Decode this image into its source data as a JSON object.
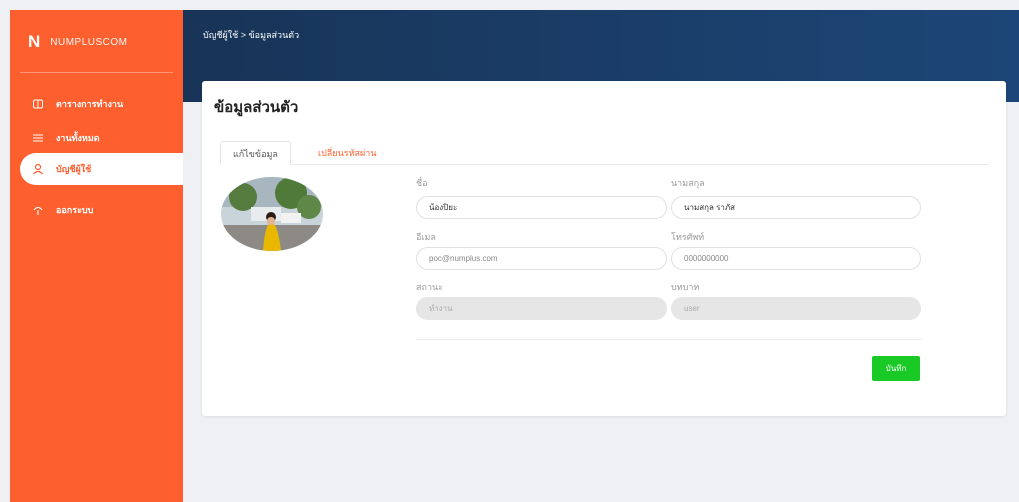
{
  "brand": {
    "logo": "N",
    "name": "NUMPLUSCOM"
  },
  "nav": {
    "items": [
      {
        "label": "ตารางการทำงาน",
        "icon": "box-icon"
      },
      {
        "label": "งานทั้งหมด",
        "icon": "list-icon"
      },
      {
        "label": "บัญชีผู้ใช้",
        "icon": "user-icon"
      },
      {
        "label": "ออกระบบ",
        "icon": "logout-icon"
      }
    ]
  },
  "header": {
    "breadcrumb": "บัญชีผู้ใช้ > ข้อมูลส่วนตัว"
  },
  "profile": {
    "title": "ข้อมูลส่วนตัว",
    "tabs": [
      "แก้ไขข้อมูล",
      "เปลี่ยนรหัสผ่าน"
    ],
    "fields": {
      "first_name": {
        "label": "ชื่อ",
        "value": "น้องปิยะ"
      },
      "last_name": {
        "label": "นามสกุล",
        "value": "นามสกุล ราภัส"
      },
      "email": {
        "label": "อีเมล",
        "value": "poc@numplus.com"
      },
      "phone": {
        "label": "โทรศัพท์",
        "value": "0000000000"
      },
      "status": {
        "label": "สถานะ",
        "value": "ทำงาน"
      },
      "role": {
        "label": "บทบาท",
        "value": "user"
      }
    },
    "save_label": "บันทึก"
  },
  "colors": {
    "primary": "#fe5f2e",
    "header": "#183457",
    "success": "#19c925"
  }
}
